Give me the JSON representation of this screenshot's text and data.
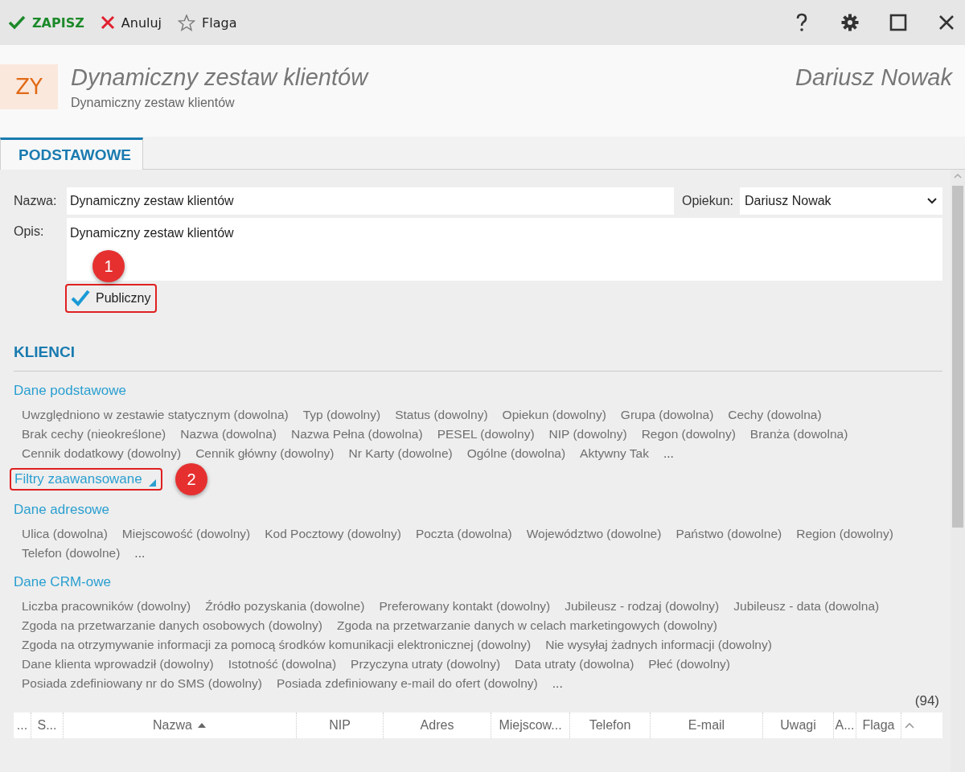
{
  "toolbar": {
    "actions": [
      {
        "kind": "save",
        "label": "ZAPISZ"
      },
      {
        "kind": "cancel",
        "label": "Anuluj"
      },
      {
        "kind": "flag",
        "label": "Flaga"
      }
    ]
  },
  "header": {
    "badge": "ZY",
    "title": "Dynamiczny zestaw klientów",
    "subtitle": "Dynamiczny zestaw klientów",
    "owner": "Dariusz Nowak"
  },
  "tabs": [
    {
      "label": "PODSTAWOWE",
      "selected": true
    }
  ],
  "form": {
    "name_label": "Nazwa:",
    "name_value": "Dynamiczny zestaw klientów",
    "owner_label": "Opiekun:",
    "owner_value": "Dariusz Nowak",
    "description_label": "Opis:",
    "description_value": "Dynamiczny zestaw klientów",
    "public": {
      "label": "Publiczny",
      "checked": true,
      "highlighted": true,
      "marker": "1"
    }
  },
  "clients": {
    "title": "KLIENCI",
    "groups": [
      {
        "kind": "group",
        "title": "Dane podstawowe",
        "filters": [
          "Uwzględniono w zestawie statycznym (dowolna)",
          "Typ (dowolny)",
          "Status (dowolny)",
          "Opiekun (dowolny)",
          "Grupa (dowolna)",
          "Cechy (dowolna)",
          "Brak cechy (nieokreślone)",
          "Nazwa (dowolna)",
          "Nazwa Pełna (dowolna)",
          "PESEL (dowolny)",
          "NIP (dowolny)",
          "Regon (dowolny)",
          "Branża (dowolna)",
          "Cennik dodatkowy (dowolny)",
          "Cennik główny (dowolny)",
          "Nr Karty (dowolne)",
          "Ogólne (dowolna)",
          "Aktywny Tak"
        ],
        "more": "..."
      },
      {
        "kind": "toggle",
        "title": "Filtry zaawansowane",
        "expanded": false,
        "highlighted": true,
        "marker": "2"
      },
      {
        "kind": "group",
        "title": "Dane adresowe",
        "filters": [
          "Ulica (dowolna)",
          "Miejscowość (dowolny)",
          "Kod Pocztowy (dowolny)",
          "Poczta (dowolna)",
          "Województwo (dowolne)",
          "Państwo (dowolne)",
          "Region (dowolny)",
          "Telefon (dowolne)"
        ],
        "more": "..."
      },
      {
        "kind": "group",
        "title": "Dane CRM-owe",
        "filters": [
          "Liczba pracowników (dowolny)",
          "Źródło pozyskania (dowolne)",
          "Preferowany kontakt (dowolny)",
          "Jubileusz - rodzaj (dowolny)",
          "Jubileusz - data (dowolna)",
          "Zgoda na przetwarzanie danych osobowych (dowolny)",
          "Zgoda na przetwarzanie danych w celach marketingowych (dowolny)",
          "Zgoda na otrzymywanie informacji za pomocą środków komunikacji elektronicznej (dowolny)",
          "Nie wysyłaj żadnych informacji (dowolny)",
          "Dane klienta wprowadził (dowolny)",
          "Istotność (dowolna)",
          "Przyczyna utraty (dowolny)",
          "Data utraty (dowolna)",
          "Płeć (dowolny)",
          "Posiada zdefiniowany nr do SMS (dowolny)",
          "Posiada zdefiniowany e-mail do ofert (dowolny)"
        ],
        "more": "..."
      }
    ]
  },
  "count": "(94)",
  "table": {
    "columns": [
      {
        "label": "..."
      },
      {
        "label": "S..."
      },
      {
        "label": "Nazwa",
        "sorted": true
      },
      {
        "label": "NIP"
      },
      {
        "label": "Adres"
      },
      {
        "label": "Miejscow..."
      },
      {
        "label": "Telefon"
      },
      {
        "label": "E-mail"
      },
      {
        "label": "Uwagi"
      },
      {
        "label": "A..."
      },
      {
        "label": "Flaga"
      }
    ]
  }
}
